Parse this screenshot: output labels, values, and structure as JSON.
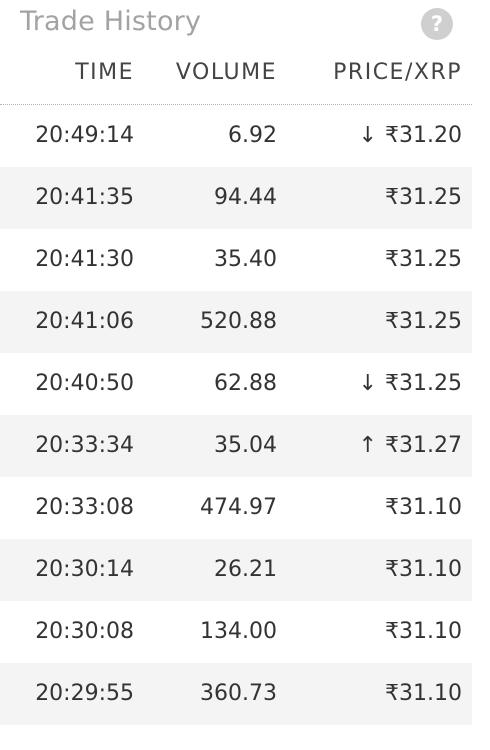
{
  "header": {
    "title": "Trade History",
    "help_label": "?"
  },
  "columns": {
    "time": "TIME",
    "volume": "VOLUME",
    "price": "PRICE/XRP"
  },
  "colors": {
    "down": "#b03a32",
    "up": "#7a857c",
    "neutral": "#333333"
  },
  "rows": [
    {
      "time": "20:49:14",
      "volume": "6.92",
      "price": "₹31.20",
      "direction": "down",
      "arrow": "↓"
    },
    {
      "time": "20:41:35",
      "volume": "94.44",
      "price": "₹31.25",
      "direction": "none",
      "arrow": ""
    },
    {
      "time": "20:41:30",
      "volume": "35.40",
      "price": "₹31.25",
      "direction": "none",
      "arrow": ""
    },
    {
      "time": "20:41:06",
      "volume": "520.88",
      "price": "₹31.25",
      "direction": "none",
      "arrow": ""
    },
    {
      "time": "20:40:50",
      "volume": "62.88",
      "price": "₹31.25",
      "direction": "down",
      "arrow": "↓"
    },
    {
      "time": "20:33:34",
      "volume": "35.04",
      "price": "₹31.27",
      "direction": "up",
      "arrow": "↑"
    },
    {
      "time": "20:33:08",
      "volume": "474.97",
      "price": "₹31.10",
      "direction": "none",
      "arrow": ""
    },
    {
      "time": "20:30:14",
      "volume": "26.21",
      "price": "₹31.10",
      "direction": "none",
      "arrow": ""
    },
    {
      "time": "20:30:08",
      "volume": "134.00",
      "price": "₹31.10",
      "direction": "none",
      "arrow": ""
    },
    {
      "time": "20:29:55",
      "volume": "360.73",
      "price": "₹31.10",
      "direction": "none",
      "arrow": ""
    }
  ]
}
